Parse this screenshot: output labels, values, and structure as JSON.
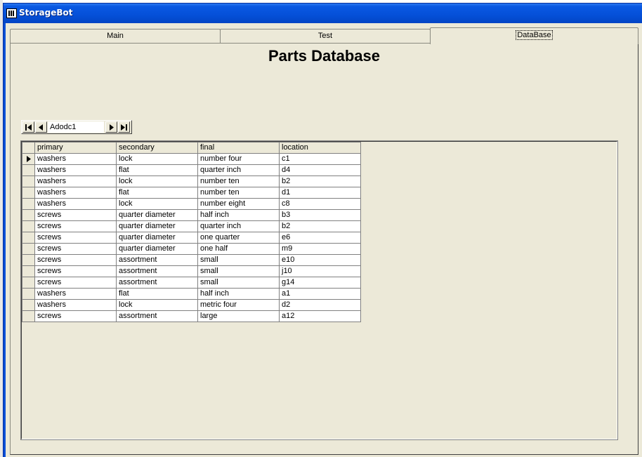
{
  "window": {
    "title": "StorageBot"
  },
  "tabs": [
    {
      "label": "Main"
    },
    {
      "label": "Test"
    },
    {
      "label": "DataBase"
    }
  ],
  "page_title": "Parts Database",
  "adodc": {
    "caption": "Adodc1"
  },
  "grid": {
    "columns": [
      "primary",
      "secondary",
      "final",
      "location"
    ],
    "current_row": 0,
    "rows": [
      [
        "washers",
        "lock",
        "number four",
        "c1"
      ],
      [
        "washers",
        "flat",
        "quarter inch",
        "d4"
      ],
      [
        "washers",
        "lock",
        "number ten",
        "b2"
      ],
      [
        "washers",
        "flat",
        "number ten",
        "d1"
      ],
      [
        "washers",
        "lock",
        "number eight",
        "c8"
      ],
      [
        "screws",
        "quarter diameter",
        "half inch",
        "b3"
      ],
      [
        "screws",
        "quarter diameter",
        "quarter inch",
        "b2"
      ],
      [
        "screws",
        "quarter diameter",
        "one quarter",
        "e6"
      ],
      [
        "screws",
        "quarter diameter",
        "one half",
        "m9"
      ],
      [
        "screws",
        "assortment",
        "small",
        "e10"
      ],
      [
        "screws",
        "assortment",
        "small",
        "j10"
      ],
      [
        "screws",
        "assortment",
        "small",
        "g14"
      ],
      [
        "washers",
        "flat",
        "half inch",
        "a1"
      ],
      [
        "washers",
        "lock",
        "metric four",
        "d2"
      ],
      [
        "screws",
        "assortment",
        "large",
        "a12"
      ]
    ]
  },
  "colors": {
    "titlebar": "#0550d8",
    "face": "#ece9d8"
  }
}
